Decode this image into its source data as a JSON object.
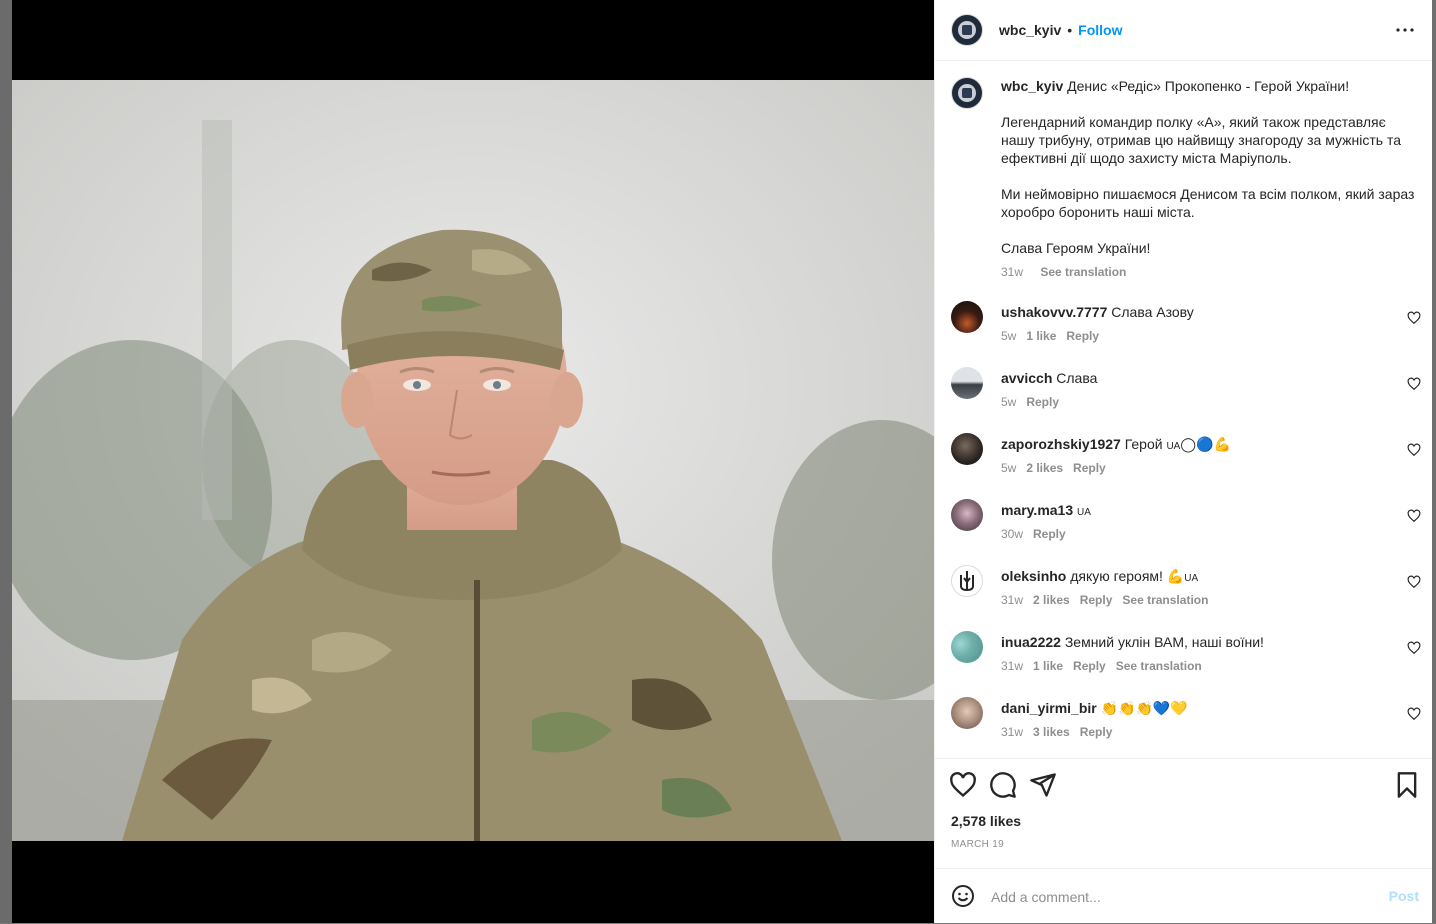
{
  "post": {
    "username": "wbc_kyiv",
    "dot": "•",
    "follow_label": "Follow",
    "more_label": "•••",
    "caption": {
      "username": "wbc_kyiv",
      "title": "Денис «Редіс» Прокопенко - Герой України!",
      "paragraph1": "Легендарний командир полку «А», який також представляє нашу трибуну, отримав цю найвищу знагороду за мужність та ефективні дії щодо захисту міста Маріуполь.",
      "paragraph2": "Ми неймовірно пишаємося Денисом та всім полком, який зараз хоробро боронить наші міста.",
      "paragraph3": "Слава Героям України!",
      "age": "31w",
      "see_translation": "See translation"
    },
    "comments": [
      {
        "username": "ushakovvv.7777",
        "text": "Слава Азову",
        "emoji": "",
        "age": "5w",
        "likes": "1 like",
        "reply": "Reply",
        "translation": ""
      },
      {
        "username": "avvicch",
        "text": "Слава",
        "emoji": "",
        "age": "5w",
        "likes": "",
        "reply": "Reply",
        "translation": ""
      },
      {
        "username": "zaporozhskiy1927",
        "text": "Герой",
        "flag": "UA",
        "emoji": "◯🔵💪",
        "age": "5w",
        "likes": "2 likes",
        "reply": "Reply",
        "translation": ""
      },
      {
        "username": "mary.ma13",
        "text": "",
        "flag": "UA",
        "emoji": "",
        "age": "30w",
        "likes": "",
        "reply": "Reply",
        "translation": ""
      },
      {
        "username": "oleksinho",
        "text": "дякую героям!",
        "flag": "UA",
        "emoji": "💪",
        "age": "31w",
        "likes": "2 likes",
        "reply": "Reply",
        "translation": "See translation"
      },
      {
        "username": "inua2222",
        "text": "Земний уклін ВАМ, наші воїни!",
        "emoji": "",
        "age": "31w",
        "likes": "1 like",
        "reply": "Reply",
        "translation": "See translation"
      },
      {
        "username": "dani_yirmi_bir",
        "text": "",
        "emoji": "👏👏👏💙💛",
        "age": "31w",
        "likes": "3 likes",
        "reply": "Reply",
        "translation": ""
      }
    ],
    "likes_count": "2,578 likes",
    "date": "MARCH 19",
    "comment_placeholder": "Add a comment...",
    "post_label": "Post"
  },
  "colors": {
    "accent": "#0095f6",
    "text": "#262626",
    "muted": "#8e8e8e",
    "post_disabled": "#b2dffc"
  },
  "icons": [
    "more-options-icon",
    "heart-icon",
    "comment-icon",
    "share-icon",
    "bookmark-icon",
    "emoji-icon"
  ]
}
